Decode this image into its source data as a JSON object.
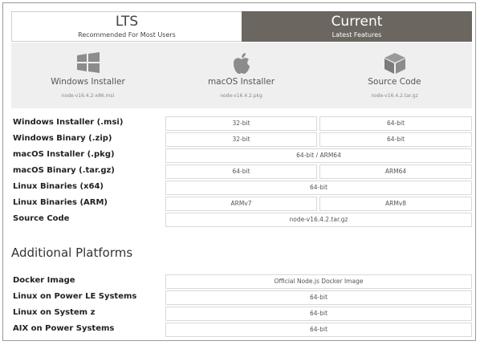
{
  "tabs": {
    "lts": {
      "title": "LTS",
      "subtitle": "Recommended For Most Users"
    },
    "current": {
      "title": "Current",
      "subtitle": "Latest Features"
    }
  },
  "downloads": [
    {
      "icon": "windows-icon",
      "label": "Windows Installer",
      "file": "node-v16.4.2-x86.msi"
    },
    {
      "icon": "apple-icon",
      "label": "macOS Installer",
      "file": "node-v16.4.2.pkg"
    },
    {
      "icon": "box-icon",
      "label": "Source Code",
      "file": "node-v16.4.2.tar.gz"
    }
  ],
  "table": {
    "rows": [
      {
        "label": "Windows Installer (.msi)",
        "cells": [
          "32-bit",
          "64-bit"
        ]
      },
      {
        "label": "Windows Binary (.zip)",
        "cells": [
          "32-bit",
          "64-bit"
        ]
      },
      {
        "label": "macOS Installer (.pkg)",
        "cells": [
          "64-bit / ARM64"
        ]
      },
      {
        "label": "macOS Binary (.tar.gz)",
        "cells": [
          "64-bit",
          "ARM64"
        ]
      },
      {
        "label": "Linux Binaries (x64)",
        "cells": [
          "64-bit"
        ]
      },
      {
        "label": "Linux Binaries (ARM)",
        "cells": [
          "ARMv7",
          "ARMv8"
        ]
      },
      {
        "label": "Source Code",
        "cells": [
          "node-v16.4.2.tar.gz"
        ]
      }
    ]
  },
  "additional": {
    "title": "Additional Platforms",
    "rows": [
      {
        "label": "Docker Image",
        "cells": [
          "Official Node.js Docker Image"
        ]
      },
      {
        "label": "Linux on Power LE Systems",
        "cells": [
          "64-bit"
        ]
      },
      {
        "label": "Linux on System z",
        "cells": [
          "64-bit"
        ]
      },
      {
        "label": "AIX on Power Systems",
        "cells": [
          "64-bit"
        ]
      }
    ]
  },
  "colors": {
    "active_tab": "#6b6660",
    "panel": "#efefef",
    "cell_border": "#d9d9d9"
  }
}
